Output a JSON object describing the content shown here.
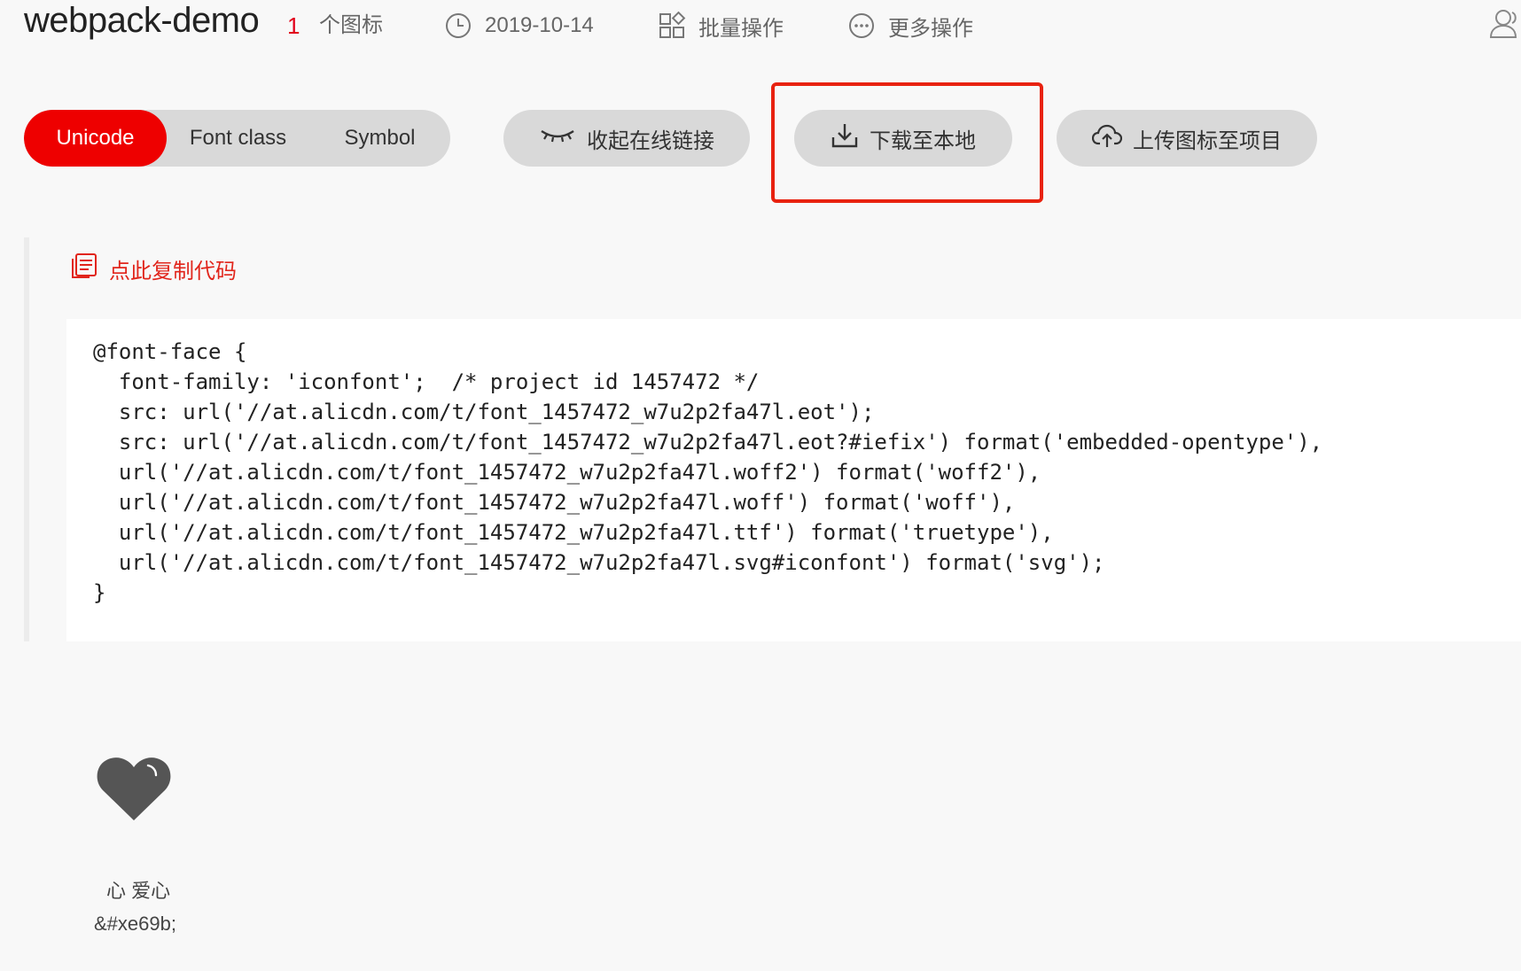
{
  "header": {
    "project_title": "webpack-demo",
    "icon_count": "1",
    "icon_count_label": "个图标",
    "date": "2019-10-14",
    "batch_label": "批量操作",
    "more_label": "更多操作"
  },
  "tabs": [
    {
      "label": "Unicode",
      "active": true
    },
    {
      "label": "Font class",
      "active": false
    },
    {
      "label": "Symbol",
      "active": false
    }
  ],
  "actions": {
    "collapse_label": "收起在线链接",
    "download_label": "下载至本地",
    "upload_label": "上传图标至项目"
  },
  "code_panel": {
    "copy_label": "点此复制代码",
    "code": "@font-face {\n  font-family: 'iconfont';  /* project id 1457472 */\n  src: url('//at.alicdn.com/t/font_1457472_w7u2p2fa47l.eot');\n  src: url('//at.alicdn.com/t/font_1457472_w7u2p2fa47l.eot?#iefix') format('embedded-opentype'),\n  url('//at.alicdn.com/t/font_1457472_w7u2p2fa47l.woff2') format('woff2'),\n  url('//at.alicdn.com/t/font_1457472_w7u2p2fa47l.woff') format('woff'),\n  url('//at.alicdn.com/t/font_1457472_w7u2p2fa47l.ttf') format('truetype'),\n  url('//at.alicdn.com/t/font_1457472_w7u2p2fa47l.svg#iconfont') format('svg');\n}"
  },
  "icons": [
    {
      "name": "心 爱心",
      "code": "&#xe69b;",
      "glyph": "heart-icon"
    }
  ],
  "colors": {
    "accent": "#ee0000",
    "highlight": "#e8220f",
    "pill_bg": "#d9d9d9",
    "page_bg": "#f8f8f8"
  }
}
